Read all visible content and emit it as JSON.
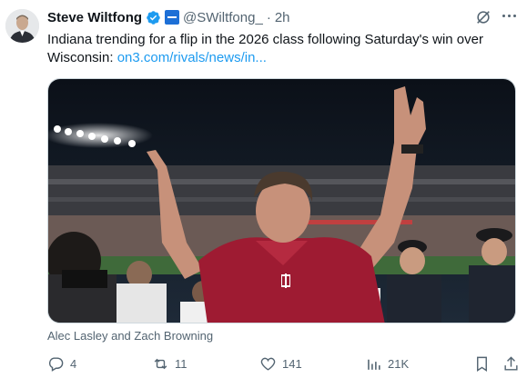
{
  "tweet": {
    "author_name": "Steve Wiltfong",
    "handle": "@SWiltfong_",
    "separator": "·",
    "time": "2h",
    "text": "Indiana trending for a flip in the 2026 class following Saturday's win over Wisconsin: ",
    "link_text": "on3.com/rivals/news/in...",
    "media_caption": "Alec Lasley and Zach Browning"
  },
  "actions": {
    "replies": "4",
    "reposts": "11",
    "likes": "141",
    "views": "21K"
  },
  "colors": {
    "text": "#0f1419",
    "secondary": "#536471",
    "link": "#1d9bf0",
    "verified": "#1d9bf0",
    "jersey": "#9e1b32"
  }
}
